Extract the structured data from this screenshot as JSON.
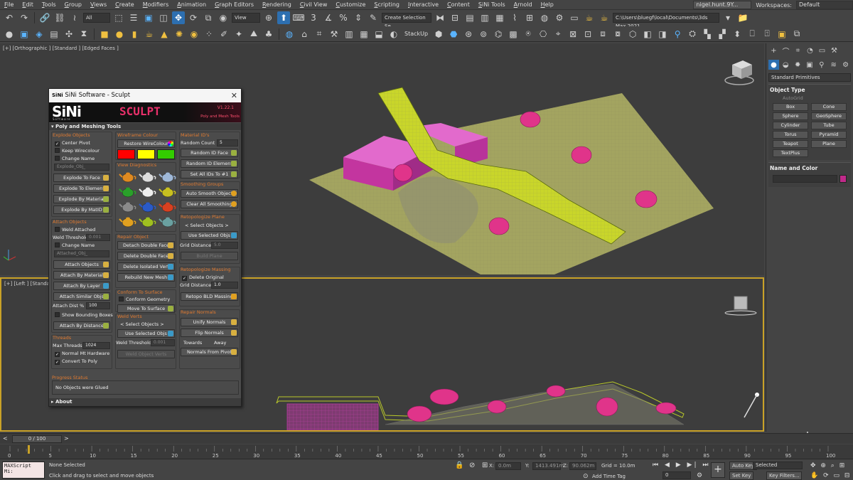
{
  "menus": [
    "File",
    "Edit",
    "Tools",
    "Group",
    "Views",
    "Create",
    "Modifiers",
    "Animation",
    "Graph Editors",
    "Rendering",
    "Civil View",
    "Customize",
    "Scripting",
    "Interactive",
    "Content",
    "SiNi Tools",
    "Arnold",
    "Help"
  ],
  "user": "nigel.hunt.9Y...",
  "workspaces_label": "Workspaces:",
  "workspace_value": "Default",
  "toolbar": {
    "filter": "All",
    "view": "View",
    "selection_set": "Create Selection Se",
    "project_path": "C:\\Users\\bluegf\\local\\Documents\\3ds Max 2021",
    "stackup": "StackUp"
  },
  "viewports": {
    "top_label": "[+] [Orthographic ] [Standard ] [Edged Faces ]",
    "bottom_label": "[+] [Left ] [Standard ]"
  },
  "command_panel": {
    "category": "Standard Primitives",
    "object_type_header": "Object Type",
    "autogrid": "AutoGrid",
    "buttons": [
      "Box",
      "Cone",
      "Sphere",
      "GeoSphere",
      "Cylinder",
      "Tube",
      "Torus",
      "Pyramid",
      "Teapot",
      "Plane",
      "TextPlus"
    ],
    "name_color_header": "Name and Color",
    "object_color": "#c02a8a"
  },
  "sini": {
    "window_title": "SiNi Software - Sculpt",
    "logo": "SiNi",
    "logo_sub": "Software",
    "product": "SCULPT",
    "version": "V1.22.1",
    "subtitle": "Poly and Mesh Tools",
    "rollout": "Poly and Meshing Tools",
    "explode": {
      "header": "Explode Objects",
      "center_pivot": "Center Pivot",
      "keep_wirecolour": "Keep Wirecolour",
      "change_name": "Change Name",
      "name_placeholder": "Explode_Obj_",
      "buttons": [
        "Explode To Face",
        "Explode To Element",
        "Explode By Material",
        "Explode By MatID"
      ]
    },
    "attach": {
      "header": "Attach Objects",
      "weld_attached": "Weld Attached",
      "weld_threshold_label": "Weld Threshold",
      "weld_threshold": "0.001",
      "change_name": "Change Name",
      "name_placeholder": "Attached_Obj_",
      "buttons": [
        "Attach Objects",
        "Attach By Material",
        "Attach By Layer",
        "Attach Similar Objs"
      ],
      "dist_label": "Attach Dist %",
      "dist_value": "100",
      "show_bbox": "Show Bounding Boxes",
      "by_distance": "Attach By Distance"
    },
    "threads": {
      "header": "Threads",
      "max_label": "Max Threads",
      "max_value": "1024",
      "normal_mt": "Normal Mt Hardware",
      "convert_poly": "Convert To Poly"
    },
    "wire": {
      "header": "Wireframe Colour",
      "restore": "Restore WireColour",
      "colors": [
        "#ff0000",
        "#ffff00",
        "#33cc00"
      ]
    },
    "diag": {
      "header": "View Diagnostics"
    },
    "repair": {
      "header": "Repair Object",
      "buttons": [
        "Detach Double Face",
        "Delete Double Face",
        "Delete Isolated Vert",
        "Rebuild New Mesh"
      ]
    },
    "conform": {
      "header": "Conform To Surface",
      "conform_geometry": "Conform Geometry",
      "move_to_surface": "Move To Surface"
    },
    "weld": {
      "header": "Weld Verts",
      "select_objects": "< Select Objects >",
      "use_selected": "Use Selected Objs",
      "threshold_label": "Weld Threshold",
      "threshold_value": "0.001",
      "weld_button": "Weld Object Verts"
    },
    "material": {
      "header": "Material ID's",
      "random_count_label": "Random Count",
      "random_count": "5",
      "buttons": [
        "Random ID Face",
        "Random ID Element",
        "Set All IDs To #1"
      ]
    },
    "smoothing": {
      "header": "Smoothing Groups",
      "buttons": [
        "Auto Smooth Object",
        "Clear All Smoothing"
      ]
    },
    "retopo_plane": {
      "header": "Retopologize Plane",
      "select_objects": "< Select Objects >",
      "use_selected": "Use Selected Objs",
      "grid_label": "Grid Distance",
      "grid_value": "5.0",
      "build": "Build Plane"
    },
    "retopo_massing": {
      "header": "Retopologize Massing",
      "delete_original": "Delete Original",
      "grid_label": "Grid Distance",
      "grid_value": "1.0",
      "button": "Retopo BLD Massing"
    },
    "normals": {
      "header": "Repair Normals",
      "unify": "Unify Normals",
      "flip": "Flip Normals",
      "towards": "Towards",
      "away": "Away",
      "from_pivot": "Normals From Pivot"
    },
    "progress_header": "Progress Status",
    "progress_text": "No Objects were Glued",
    "about": "About"
  },
  "timeline": {
    "frame": "0 / 100",
    "ticks": [
      "0",
      "5",
      "10",
      "15",
      "20",
      "25",
      "30",
      "35",
      "40",
      "45",
      "50",
      "55",
      "60",
      "65",
      "70",
      "75",
      "80",
      "85",
      "90",
      "95",
      "100"
    ]
  },
  "status": {
    "maxscript": "MAXScript Mi:",
    "selection": "None Selected",
    "prompt": "Click and drag to select and move objects",
    "x_label": "X:",
    "x_value": "0.0m",
    "y_label": "Y:",
    "y_value": "1413.491m",
    "z_label": "Z:",
    "z_value": "90.062m",
    "grid": "Grid = 10.0m",
    "add_time_tag": "Add Time Tag",
    "auto_key": "Auto Key",
    "set_key": "Set Key",
    "selected": "Selected",
    "key_filters": "Key Filters...",
    "frame_value": "0"
  }
}
